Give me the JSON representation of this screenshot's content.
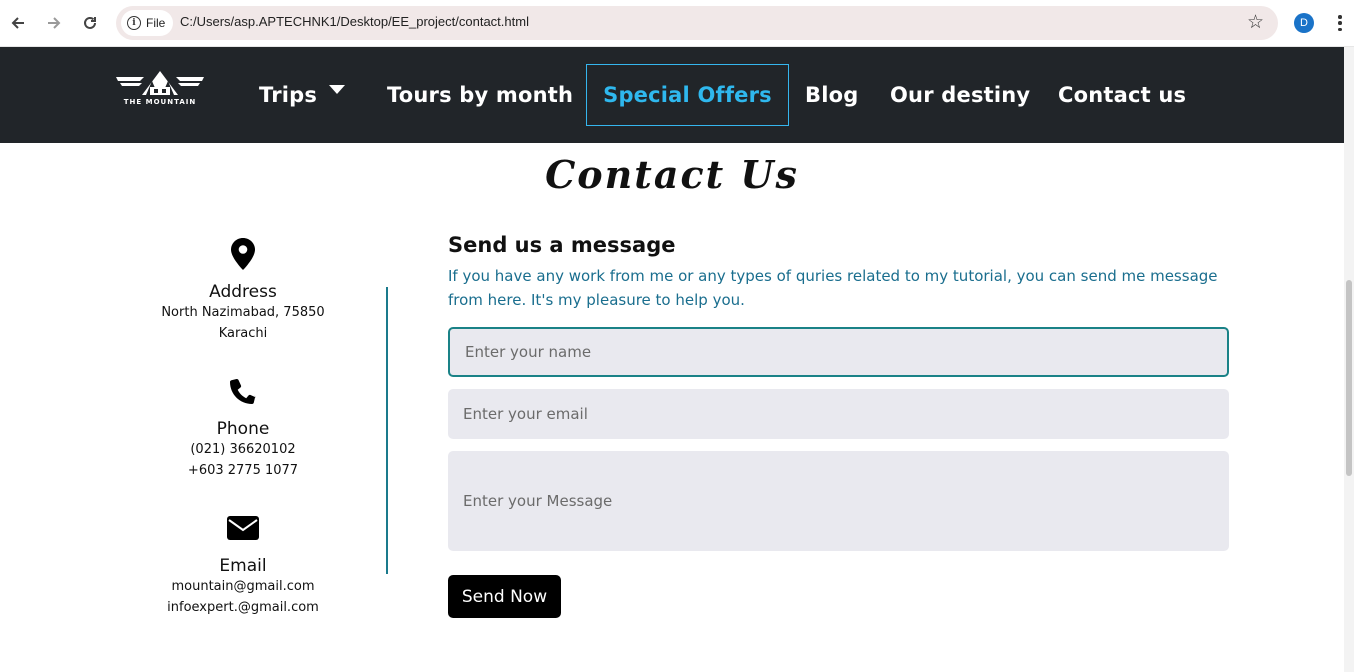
{
  "browser": {
    "chip_label": "File",
    "url": "C:/Users/asp.APTECHNK1/Desktop/EE_project/contact.html",
    "profile_initial": "D"
  },
  "header": {
    "logo_text": "THE MOUNTAIN",
    "nav": {
      "trips": "Trips",
      "tours": "Tours by month",
      "special": "Special Offers",
      "blog": "Blog",
      "destiny": "Our destiny",
      "contact": "Contact us"
    },
    "active_color": "#2fb8ee",
    "background": "#212529"
  },
  "page": {
    "title": "Contact Us"
  },
  "info": {
    "address": {
      "heading": "Address",
      "lines": [
        "North Nazimabad, 75850",
        "Karachi"
      ]
    },
    "phone": {
      "heading": "Phone",
      "lines": [
        "(021) 36620102",
        "+603 2775 1077"
      ]
    },
    "email": {
      "heading": "Email",
      "lines": [
        "mountain@gmail.com",
        "infoexpert.@gmail.com"
      ]
    }
  },
  "form": {
    "heading": "Send us a message",
    "description": "If you have any work from me or any types of quries related to my tutorial, you can send me message from here. It's my pleasure to help you.",
    "name_placeholder": "Enter your name",
    "email_placeholder": "Enter your email",
    "message_placeholder": "Enter your Message",
    "submit_label": "Send Now"
  }
}
